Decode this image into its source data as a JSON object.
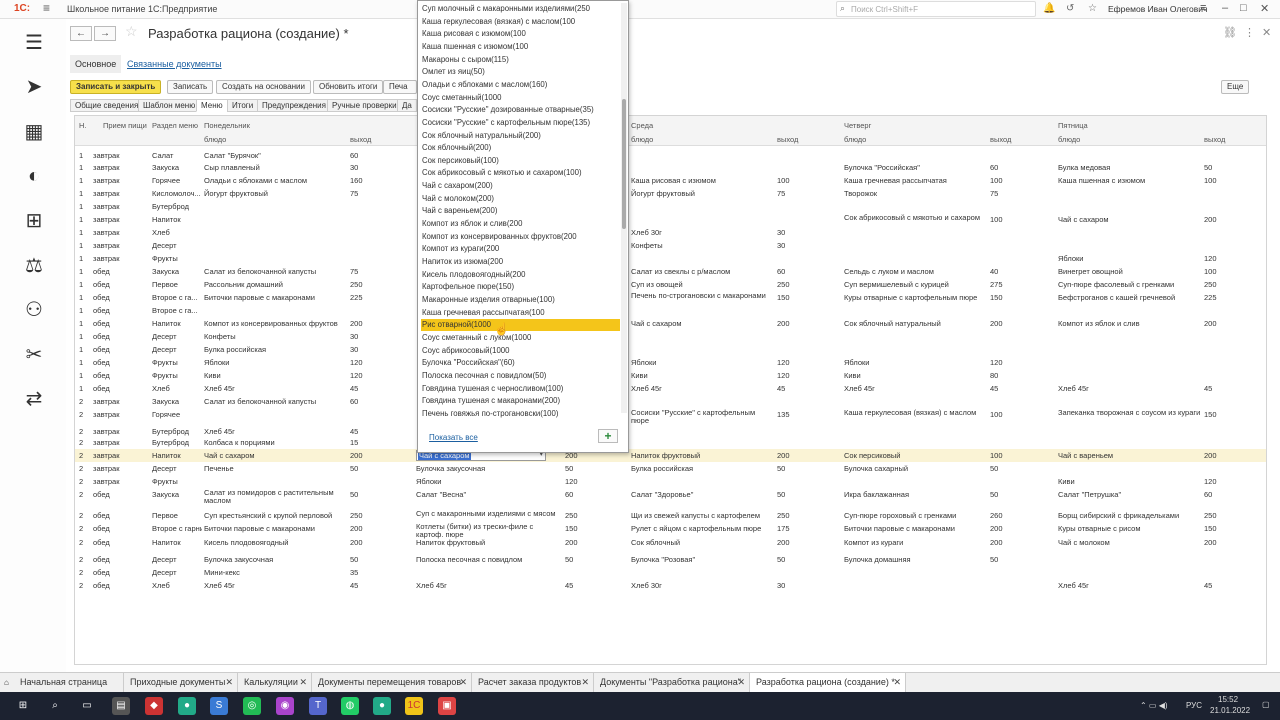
{
  "titlebar": {
    "logo": "1С:",
    "app_title": "Школьное питание 1С:Предприятие",
    "search_placeholder": "Поиск Ctrl+Shift+F",
    "user": "Ефремов Иван Олегович"
  },
  "document": {
    "title": "Разработка рациона (создание) *",
    "sections": [
      "Основное",
      "Связанные документы"
    ]
  },
  "toolbar": {
    "save_close": "Записать и закрыть",
    "save": "Записать",
    "create_based": "Создать на основании",
    "refresh": "Обновить итоги",
    "print": "Печа",
    "more": "Еще"
  },
  "tabs": [
    "Общие сведения",
    "Шаблон меню",
    "Меню",
    "Итоги",
    "Предупреждения",
    "Ручные проверки",
    "Да"
  ],
  "grid": {
    "headers": {
      "n": "Н.",
      "meal": "Прием пищи",
      "section": "Раздел меню",
      "mon": "Понедельник",
      "wed": "Среда",
      "thu": "Четверг",
      "fri": "Пятница",
      "dish": "блюдо",
      "output": "выход"
    },
    "rows": [
      [
        "1",
        "завтрак",
        "Салат",
        "Салат \"Бурячок\"",
        "60",
        "",
        "",
        "",
        "",
        "",
        "",
        "",
        "",
        ""
      ],
      [
        "1",
        "завтрак",
        "Закуска",
        "Сыр плавленый",
        "30",
        "",
        "",
        "",
        "",
        "Булочка \"Российская\"",
        "60",
        "Булка медовая",
        "50"
      ],
      [
        "1",
        "завтрак",
        "Горячее",
        "Оладьи с яблоками с маслом",
        "160",
        "",
        "",
        "Каша рисовая с изюмом",
        "100",
        "Каша гречневая рассыпчатая",
        "100",
        "Каша пшенная с изюмом",
        "100"
      ],
      [
        "1",
        "завтрак",
        "Кисломолоч...",
        "Йогурт фруктовый",
        "75",
        "",
        "",
        "Йогурт фруктовый",
        "75",
        "Творожок",
        "75",
        "",
        ""
      ],
      [
        "1",
        "завтрак",
        "Бутерброд",
        "",
        "",
        "",
        "",
        "",
        "",
        "",
        "",
        "",
        ""
      ],
      [
        "1",
        "завтрак",
        "Напиток",
        "",
        "",
        "",
        "",
        "",
        "",
        "Сок абрикосовый с мякотью и сахаром",
        "100",
        "Чай с сахаром",
        "200"
      ],
      [
        "1",
        "завтрак",
        "Хлеб",
        "",
        "",
        "",
        "",
        "Хлеб 30г",
        "30",
        "",
        "",
        "",
        ""
      ],
      [
        "1",
        "завтрак",
        "Десерт",
        "",
        "",
        "",
        "",
        "Конфеты",
        "30",
        "",
        "",
        "",
        ""
      ],
      [
        "1",
        "завтрак",
        "Фрукты",
        "",
        "",
        "",
        "",
        "",
        "",
        "",
        "",
        "Яблоки",
        "120"
      ],
      [
        "1",
        "обед",
        "Закуска",
        "Салат из белокочанной капусты",
        "75",
        "",
        "",
        "Салат из свеклы с р/маслом",
        "60",
        "Сельдь с луком и маслом",
        "40",
        "Винегрет овощной",
        "100"
      ],
      [
        "1",
        "обед",
        "Первое",
        "Рассольник домашний",
        "250",
        "",
        "",
        "Суп из овощей",
        "250",
        "Суп вермишелевый с курицей",
        "275",
        "Суп-пюре фасолевый с гренками",
        "250"
      ],
      [
        "1",
        "обед",
        "Второе с га...",
        "Биточки паровые с макаронами",
        "225",
        "",
        "",
        "Печень по-строгановски с макаронами",
        "150",
        "Куры отварные с картофельным пюре",
        "150",
        "Бефстроганов с кашей гречневой",
        "225"
      ],
      [
        "1",
        "обед",
        "Второе с га...",
        "",
        "",
        "",
        "",
        "",
        "",
        "",
        "",
        "",
        ""
      ],
      [
        "1",
        "обед",
        "Напиток",
        "Компот из консервированных фруктов",
        "200",
        "",
        "",
        "Чай с сахаром",
        "200",
        "Сок яблочный натуральный",
        "200",
        "Компот из яблок и слив",
        "200"
      ],
      [
        "1",
        "обед",
        "Десерт",
        "Конфеты",
        "30",
        "",
        "",
        "",
        "",
        "",
        "",
        "",
        ""
      ],
      [
        "1",
        "обед",
        "Десерт",
        "Булка российская",
        "30",
        "",
        "",
        "",
        "",
        "",
        "",
        "",
        ""
      ],
      [
        "1",
        "обед",
        "Фрукты",
        "Яблоки",
        "120",
        "",
        "",
        "Яблоки",
        "120",
        "Яблоки",
        "120",
        "",
        ""
      ],
      [
        "1",
        "обед",
        "Фрукты",
        "Киви",
        "120",
        "",
        "",
        "Киви",
        "120",
        "Киви",
        "80",
        "",
        ""
      ],
      [
        "1",
        "обед",
        "Хлеб",
        "Хлеб 45г",
        "45",
        "",
        "",
        "Хлеб 45г",
        "45",
        "Хлеб 45г",
        "45",
        "Хлеб 45г",
        "45"
      ],
      [
        "2",
        "завтрак",
        "Закуска",
        "Салат из белокочанной капусты",
        "60",
        "",
        "",
        "",
        "",
        "",
        "",
        "",
        ""
      ],
      [
        "2",
        "завтрак",
        "Горячее",
        "",
        "",
        "",
        "",
        "Сосиски \"Русские\" с картофельным пюре",
        "135",
        "Каша геркулесовая (вязкая) с маслом",
        "100",
        "Запеканка творожная с соусом из кураги",
        "150"
      ],
      [
        "2",
        "завтрак",
        "Бутерброд",
        "Хлеб 45г",
        "45",
        "",
        "",
        "",
        "",
        "",
        "",
        "",
        ""
      ],
      [
        "2",
        "завтрак",
        "Бутерброд",
        "Колбаса к порциями",
        "15",
        "",
        "",
        "",
        "",
        "",
        "",
        "",
        ""
      ],
      [
        "2",
        "завтрак",
        "Напиток",
        "Чай с сахаром",
        "200",
        "Чай с сахаром",
        "200",
        "Напиток фруктовый",
        "200",
        "Сок персиковый",
        "100",
        "Чай с вареньем",
        "200"
      ],
      [
        "2",
        "завтрак",
        "Десерт",
        "Печенье",
        "50",
        "Булочка закусочная",
        "50",
        "Булка российская",
        "50",
        "Булочка сахарный",
        "50",
        "",
        ""
      ],
      [
        "2",
        "завтрак",
        "Фрукты",
        "",
        "",
        "Яблоки",
        "120",
        "",
        "",
        "",
        "",
        "Киви",
        "120"
      ],
      [
        "2",
        "обед",
        "Закуска",
        "Салат из помидоров с растительным маслом",
        "50",
        "Салат \"Весна\"",
        "60",
        "Салат \"Здоровье\"",
        "50",
        "Икра баклажанная",
        "50",
        "Салат \"Петрушка\"",
        "60"
      ],
      [
        "2",
        "обед",
        "Первое",
        "Суп крестьянский с крупой перловой",
        "250",
        "Суп с макаронными изделиями с мясом",
        "250",
        "Щи из свежей капусты с картофелем",
        "250",
        "Суп-пюре гороховый с гренками",
        "260",
        "Борщ сибирский с фрикадельками",
        "250"
      ],
      [
        "2",
        "обед",
        "Второе с гарниром",
        "Биточки паровые с макаронами",
        "200",
        "Котлеты (битки) из трески-филе с картоф. пюре",
        "150",
        "Рулет с яйцом с картофельным пюре",
        "175",
        "Биточки паровые с макаронами",
        "200",
        "Куры отварные с рисом",
        "150"
      ],
      [
        "2",
        "обед",
        "Напиток",
        "Кисель плодовоягодный",
        "200",
        "Напиток фруктовый",
        "200",
        "Сок яблочный",
        "200",
        "Компот из кураги",
        "200",
        "Чай с молоком",
        "200"
      ],
      [
        "2",
        "обед",
        "Десерт",
        "Булочка закусочная",
        "50",
        "Полоска песочная с повидлом",
        "50",
        "Булочка \"Розовая\"",
        "50",
        "Булочка домашняя",
        "50",
        "",
        ""
      ],
      [
        "2",
        "обед",
        "Десерт",
        "Мини-кекс",
        "35",
        "",
        "",
        "",
        "",
        "",
        "",
        "",
        ""
      ],
      [
        "2",
        "обед",
        "Хлеб",
        "Хлеб 45г",
        "45",
        "Хлеб 45г",
        "45",
        "Хлеб 30г",
        "30",
        "",
        "",
        "Хлеб 45г",
        "45"
      ]
    ]
  },
  "dropdown": {
    "items": [
      "Суп молочный с макаронными изделиями(250",
      "Каша геркулесовая (вязкая) с маслом(100",
      "Каша рисовая с изюмом(100",
      "Каша пшенная с изюмом(100",
      "Макароны с сыром(115)",
      "Омлет из яиц(50)",
      "Оладьи с яблоками с маслом(160)",
      "Соус сметанный(1000",
      "Сосиски \"Русские\" дозированные отварные(35)",
      "Сосиски \"Русские\" с картофельным пюре(135)",
      "Сок яблочный натуральный(200)",
      "Сок яблочный(200)",
      "Сок персиковый(100)",
      "Сок абрикосовый с мякотью и сахаром(100)",
      "Чай с сахаром(200)",
      "Чай с молоком(200)",
      "Чай с вареньем(200)",
      "Компот из яблок и слив(200",
      "Компот из консервированных фруктов(200",
      "Компот из кураги(200",
      "Напиток из изюма(200",
      "Кисель плодовоягодный(200",
      "Картофельное пюре(150)",
      "Макаронные изделия отварные(100)",
      "Каша гречневая рассыпчатая(100",
      "Рис отварной(1000",
      "Соус сметанный с луком(1000",
      "Соус абрикосовый(1000",
      "Булочка \"Российская\"(60)",
      "Полоска песочная с повидлом(50)",
      "Говядина тушеная с черносливом(100)",
      "Говядина тушеная с макаронами(200)",
      "Печень говяжья по-строгановски(100)"
    ],
    "highlighted_index": 25,
    "show_all": "Показать все"
  },
  "window_tabs": [
    "Начальная страница",
    "Приходные документы",
    "Калькуляции",
    "Документы перемещения товаров",
    "Расчет заказа продуктов",
    "Документы \"Разработка рациона\"",
    "Разработка рациона (создание) *"
  ],
  "taskbar": {
    "lang": "РУС",
    "time": "15:52",
    "date": "21.01.2022"
  },
  "colors": {
    "accent": "#f7e04b",
    "highlight": "#f4c51a",
    "link": "#1b5fa0"
  }
}
